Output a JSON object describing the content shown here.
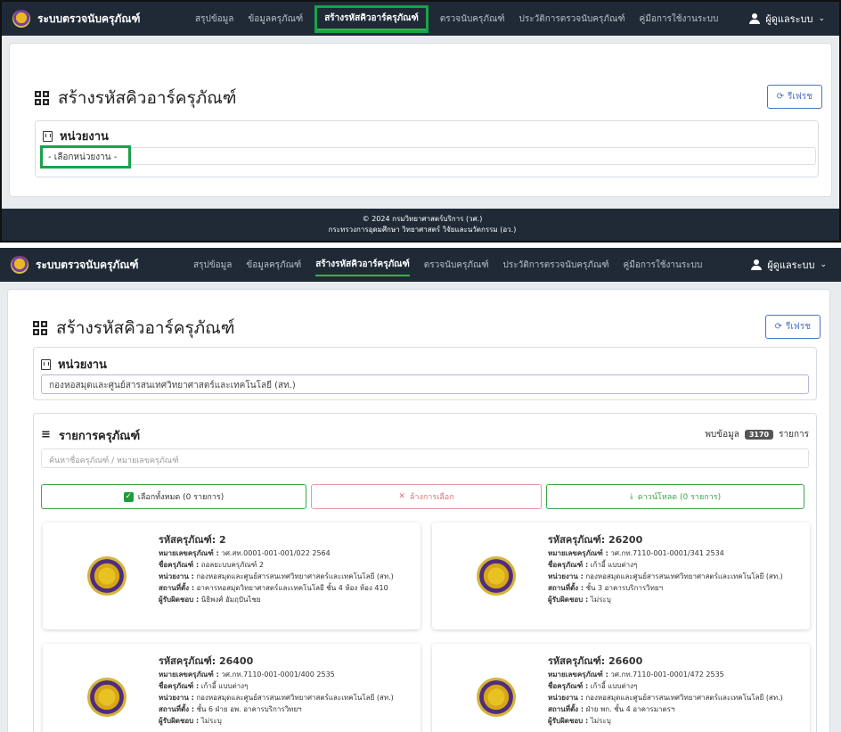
{
  "nav": {
    "brand": "ระบบตรวจนับครุภัณฑ์",
    "menu": [
      "สรุปข้อมูล",
      "ข้อมูลครุภัณฑ์",
      "สร้างรหัสคิวอาร์ครุภัณฑ์",
      "ตรวจนับครุภัณฑ์",
      "ประวัติการตรวจนับครุภัณฑ์",
      "คู่มือการใช้งานระบบ"
    ],
    "user": "ผู้ดูแลระบบ"
  },
  "page": {
    "title": "สร้างรหัสคิวอาร์ครุภัณฑ์",
    "refresh": "รีเฟรช"
  },
  "unit": {
    "title": "หน่วยงาน",
    "placeholder": "- เลือกหน่วยงาน -",
    "selected": "กองหอสมุดและศูนย์สารสนเทศวิทยาศาสตร์และเทคโนโลยี (สท.)"
  },
  "footer": {
    "line1": "© 2024 กรมวิทยาศาสตร์บริการ (วศ.)",
    "line2": "กระทรวงการอุดมศึกษา วิทยาศาสตร์ วิจัยและนวัตกรรม (อว.)"
  },
  "list": {
    "title": "รายการครุภัณฑ์",
    "found_label": "พบข้อมูล",
    "count": "3170",
    "count_unit": "รายการ",
    "search_placeholder": "ค้นหาชื่อครุภัณฑ์ / หมายเลขครุภัณฑ์",
    "btn_select_all": "เลือกทั้งหมด (0 รายการ)",
    "btn_clear": "ล้างการเลือก",
    "btn_download": "ดาวน์โหลด (0 รายการ)"
  },
  "items": [
    {
      "code": "รหัสครุภัณฑ์: 2",
      "number": "วศ.สท.0001-001-001/022 2564",
      "name": "ถอลยะบบครุภัณฑ์ 2",
      "unit": "กองหอสมุดและศูนย์สารสนเทศวิทยาศาสตร์และเทคโนโลยี (สท.)",
      "location": "อาคารหอสมุดวิทยาศาสตร์และเทคโนโลยี ชั้น 4 ห้อง ห้อง 410",
      "owner": "นิธิพงศ์ อัมฤปันไชย"
    },
    {
      "code": "รหัสครุภัณฑ์: 26200",
      "number": "วศ.กท.7110-001-0001/341 2534",
      "name": "เก้าอี้ แบบต่างๆ",
      "unit": "กองหอสมุดและศูนย์สารสนเทศวิทยาศาสตร์และเทคโนโลยี (สท.)",
      "location": "ชั้น 3 อาคารบริการวิทยฯ",
      "owner": "ไม่ระบุ"
    },
    {
      "code": "รหัสครุภัณฑ์: 26400",
      "number": "วศ.กท.7110-001-0001/400 2535",
      "name": "เก้าอี้ แบบต่างๆ",
      "unit": "กองหอสมุดและศูนย์สารสนเทศวิทยาศาสตร์และเทคโนโลยี (สท.)",
      "location": "ชั้น 6 ฝ่าย อพ. อาคารบริการวิทยฯ",
      "owner": "ไม่ระบุ"
    },
    {
      "code": "รหัสครุภัณฑ์: 26600",
      "number": "วศ.กท.7110-001-0001/472 2535",
      "name": "เก้าอี้ แบบต่างๆ",
      "unit": "กองหอสมุดและศูนย์สารสนเทศวิทยาศาสตร์และเทคโนโลยี (สท.)",
      "location": "ฝ่าย พก. ชั้น 4 อาคารมาตรฯ",
      "owner": "ไม่ระบุ"
    }
  ],
  "labels": {
    "number": "หมายเลขครุภัณฑ์ :",
    "name": "ชื่อครุภัณฑ์ :",
    "unit": "หน่วยงาน :",
    "location": "สถานที่ตั้ง :",
    "owner": "ผู้รับผิดชอบ :"
  }
}
